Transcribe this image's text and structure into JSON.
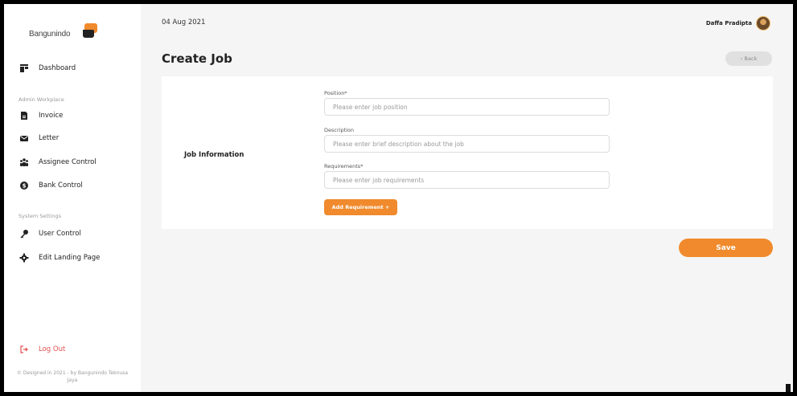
{
  "brand": {
    "name": "Bangunindo"
  },
  "header": {
    "date": "04 Aug 2021",
    "user_name": "Daffa Pradipta"
  },
  "sidebar": {
    "items": [
      {
        "label": "Dashboard",
        "icon": "dashboard-icon"
      },
      {
        "label": "Invoice",
        "icon": "invoice-icon"
      },
      {
        "label": "Letter",
        "icon": "envelope-icon"
      },
      {
        "label": "Assignee Control",
        "icon": "users-icon"
      },
      {
        "label": "Bank Control",
        "icon": "dollar-icon"
      },
      {
        "label": "User Control",
        "icon": "key-icon"
      },
      {
        "label": "Edit Landing Page",
        "icon": "gear-icon"
      }
    ],
    "sections": {
      "admin": "Admin Workplace",
      "system": "System Settings"
    },
    "logout_label": "Log Out",
    "footer": "© Designed in 2021 - by Bangunindo Teknusa Jaya"
  },
  "page": {
    "title": "Create Job",
    "back_label": "‹ Back"
  },
  "form": {
    "section_title": "Job Information",
    "position": {
      "label": "Position*",
      "placeholder": "Please enter job position",
      "value": ""
    },
    "description": {
      "label": "Description",
      "placeholder": "Please enter brief description about the job",
      "value": ""
    },
    "requirements": {
      "label": "Requirements*",
      "placeholder": "Please enter job requirements",
      "value": ""
    },
    "add_requirement_label": "Add Requirement +",
    "save_label": "Save"
  },
  "colors": {
    "accent": "#f08a2c",
    "danger": "#e54f4f",
    "background": "#f5f5f5"
  }
}
